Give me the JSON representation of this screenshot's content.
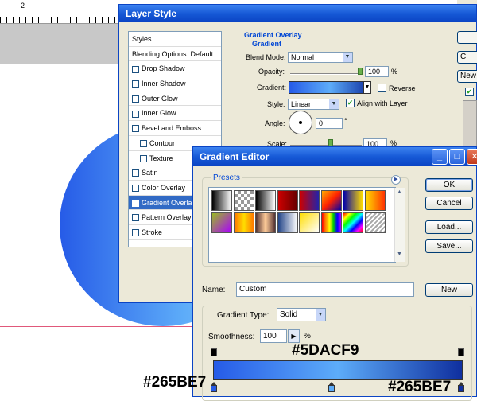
{
  "background": {
    "ruler_number": "2",
    "canvas_circle_colors": [
      "#265be7",
      "#5dacf9"
    ],
    "guide_color": "#e0587a"
  },
  "layer_style": {
    "title": "Layer Style",
    "styles_header": "Styles",
    "blending_options": "Blending Options: Default",
    "items": [
      {
        "label": "Drop Shadow",
        "checked": false,
        "indent": false
      },
      {
        "label": "Inner Shadow",
        "checked": false,
        "indent": false
      },
      {
        "label": "Outer Glow",
        "checked": false,
        "indent": false
      },
      {
        "label": "Inner Glow",
        "checked": false,
        "indent": false
      },
      {
        "label": "Bevel and Emboss",
        "checked": false,
        "indent": false
      },
      {
        "label": "Contour",
        "checked": false,
        "indent": true
      },
      {
        "label": "Texture",
        "checked": false,
        "indent": true
      },
      {
        "label": "Satin",
        "checked": false,
        "indent": false
      },
      {
        "label": "Color Overlay",
        "checked": false,
        "indent": false
      },
      {
        "label": "Gradient Overlay",
        "checked": true,
        "indent": false,
        "selected": true
      },
      {
        "label": "Pattern Overlay",
        "checked": false,
        "indent": false
      },
      {
        "label": "Stroke",
        "checked": false,
        "indent": false
      }
    ],
    "group_title": "Gradient Overlay",
    "subgroup_title": "Gradient",
    "blend_mode_label": "Blend Mode:",
    "blend_mode_value": "Normal",
    "opacity_label": "Opacity:",
    "opacity_value": "100",
    "opacity_unit": "%",
    "gradient_label": "Gradient:",
    "reverse_label": "Reverse",
    "reverse_checked": false,
    "style_label": "Style:",
    "style_value": "Linear",
    "align_label": "Align with Layer",
    "align_checked": true,
    "angle_label": "Angle:",
    "angle_value": "0",
    "angle_unit": "°",
    "scale_label": "Scale:",
    "scale_value": "100",
    "scale_unit": "%",
    "right_buttons": [
      "",
      "C",
      "New"
    ]
  },
  "gradient_editor": {
    "title": "Gradient Editor",
    "presets_label": "Presets",
    "buttons": {
      "ok": "OK",
      "cancel": "Cancel",
      "load": "Load...",
      "save": "Save...",
      "new": "New"
    },
    "name_label": "Name:",
    "name_value": "Custom",
    "gradient_type_label": "Gradient Type:",
    "gradient_type_value": "Solid",
    "smoothness_label": "Smoothness:",
    "smoothness_value": "100",
    "smoothness_unit": "%",
    "gradient_colors": [
      "#265be7",
      "#5dacf9",
      "#0f2f9f"
    ],
    "preset_swatches": [
      [
        "linear-gradient(90deg,#000,#fff)",
        "repeating-conic-gradient(#999 0 25%,#fff 0 50%) 0 0/8px 8px",
        "linear-gradient(90deg,#000,#fff)",
        "linear-gradient(90deg,#c00,#600)",
        "linear-gradient(90deg,#c00,#22a)",
        "linear-gradient(135deg,#fa0,#f20,#00a)",
        "linear-gradient(90deg,#00a,#fd0)",
        "linear-gradient(90deg,#fd0,#f30)"
      ],
      [
        "linear-gradient(135deg,#9b2,#a0f)",
        "linear-gradient(90deg,#f70,#fd0,#f70)",
        "linear-gradient(90deg,#533,#fc9,#533)",
        "linear-gradient(90deg,#248,#fff)",
        "linear-gradient(135deg,#fd0,#fff)",
        "linear-gradient(90deg,#f00,#f80,#ff0,#0c0,#00f,#a0f)",
        "linear-gradient(135deg,#f00,#ff0,#0f0,#0ff,#00f,#f0f,#f00)",
        "repeating-linear-gradient(135deg,#aaa 0 2px,#fff 2px 4px)"
      ]
    ]
  },
  "annotations": {
    "left_color": "#265BE7",
    "mid_color": "#5DACF9",
    "right_color": "#265BE7"
  }
}
